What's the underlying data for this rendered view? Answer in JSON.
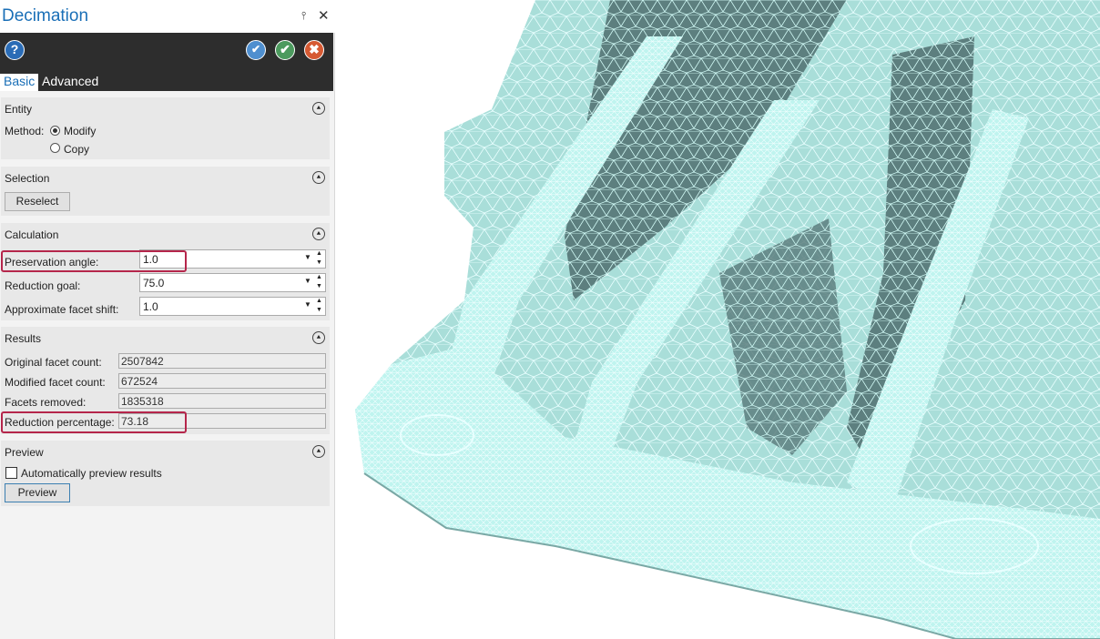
{
  "panel": {
    "title": "Decimation",
    "pin_glyph": "⫯",
    "close_glyph": "✕",
    "toolbar": {
      "help_icon": "help-icon",
      "help_glyph": "?",
      "apply_icon": "apply-plus-icon",
      "apply_glyph": "✔",
      "ok_icon": "checkmark-icon",
      "ok_glyph": "✔",
      "cancel_icon": "cancel-icon",
      "cancel_glyph": "✖"
    },
    "tabs": [
      {
        "label": "Basic",
        "active": true
      },
      {
        "label": "Advanced",
        "active": false
      }
    ],
    "entity": {
      "header": "Entity",
      "method_label": "Method:",
      "options": [
        "Modify",
        "Copy"
      ],
      "selected": "Modify"
    },
    "selection": {
      "header": "Selection",
      "reselect_label": "Reselect"
    },
    "calculation": {
      "header": "Calculation",
      "preservation_angle_label": "Preservation angle:",
      "preservation_angle_value": "1.0",
      "reduction_goal_label": "Reduction goal:",
      "reduction_goal_value": "75.0",
      "facet_shift_label": "Approximate facet shift:",
      "facet_shift_value": "1.0"
    },
    "results": {
      "header": "Results",
      "original_label": "Original facet count:",
      "original_value": "2507842",
      "modified_label": "Modified facet count:",
      "modified_value": "672524",
      "removed_label": "Facets removed:",
      "removed_value": "1835318",
      "reduction_label": "Reduction percentage:",
      "reduction_value": "73.18"
    },
    "preview": {
      "header": "Preview",
      "auto_preview_label": "Automatically preview results",
      "auto_preview_checked": false,
      "preview_button": "Preview"
    },
    "collapse_glyph": "⯅"
  },
  "colors": {
    "accent": "#1a6fb7",
    "toolbar_bg": "#2d2d2d",
    "highlight": "#b5264b",
    "mesh": "#b6f2ee",
    "mesh_shadow": "#4a6a6a"
  }
}
